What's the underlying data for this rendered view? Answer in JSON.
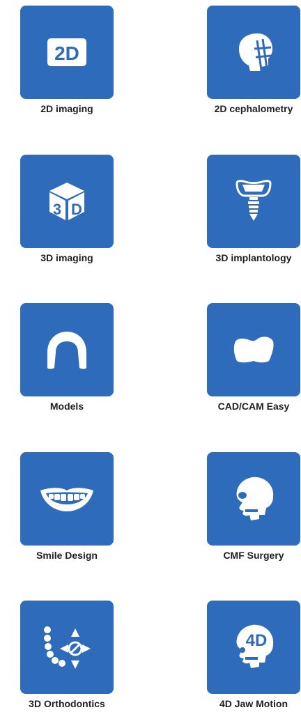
{
  "tiles": [
    {
      "label": "2D imaging",
      "icon": "2d-icon"
    },
    {
      "label": "2D cephalometry",
      "icon": "skull-ruler-icon"
    },
    {
      "label": "3D imaging",
      "icon": "3d-cube-icon"
    },
    {
      "label": "3D implantology",
      "icon": "implant-icon"
    },
    {
      "label": "Models",
      "icon": "dental-arch-icon"
    },
    {
      "label": "CAD/CAM Easy",
      "icon": "crown-icon"
    },
    {
      "label": "Smile Design",
      "icon": "smile-icon"
    },
    {
      "label": "CMF Surgery",
      "icon": "skull-icon"
    },
    {
      "label": "3D Orthodontics",
      "icon": "orthodontics-icon"
    },
    {
      "label": "4D Jaw Motion",
      "icon": "4d-skull-icon"
    }
  ],
  "icon_text": {
    "twoD": "2D",
    "threeD_a": "3",
    "threeD_b": "D",
    "fourD": "4D"
  },
  "colors": {
    "tile": "#2f6bbb",
    "label": "#1e1e1e",
    "icon": "#ffffff"
  }
}
